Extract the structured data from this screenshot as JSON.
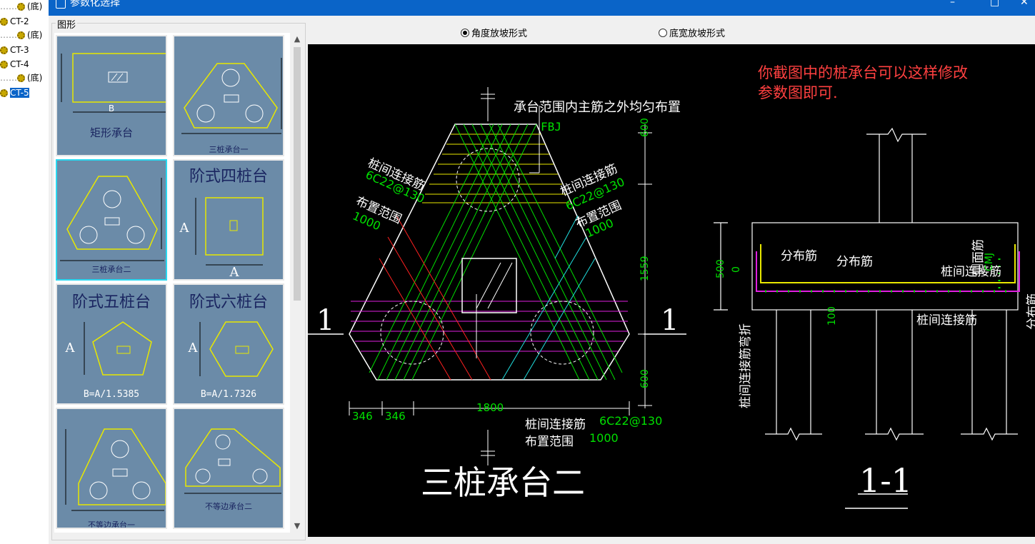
{
  "tree": {
    "items": [
      {
        "label": "(底)"
      },
      {
        "label": "CT-2"
      },
      {
        "label": "(底)"
      },
      {
        "label": "CT-3"
      },
      {
        "label": "CT-4"
      },
      {
        "label": "(底)"
      },
      {
        "label": "CT-5"
      }
    ]
  },
  "window": {
    "title": "参数化选择"
  },
  "group": {
    "label": "图形"
  },
  "gallery": {
    "cards": [
      {
        "label": "矩形承台",
        "dim": "B"
      },
      {
        "label": "三桩承台一"
      },
      {
        "label": "三桩承台二"
      },
      {
        "label": "阶式四桩台",
        "dim": "A"
      },
      {
        "label": "阶式五桩台",
        "formula": "B=A/1.5385",
        "dim": "A"
      },
      {
        "label": "阶式六桩台",
        "formula": "B=A/1.7326",
        "dim": "A"
      },
      {
        "label": "不等边承台一"
      },
      {
        "label": "不等边承台二"
      }
    ]
  },
  "options": {
    "angle_slope": "角度放坡形式",
    "width_slope": "底宽放坡形式",
    "selected": "angle_slope"
  },
  "drawing": {
    "note_top": "承台范围内主筋之外均匀布置",
    "fbj": "FBJ",
    "left_tie": "桩间连接筋",
    "left_tie_spec": "6C22@130",
    "left_range": "布置范围",
    "left_range_val": "1000",
    "right_tie": "桩间连接筋",
    "right_tie_spec": "6C22@130",
    "right_range": "布置范围",
    "right_range_val": "1000",
    "dim_600_top": "600",
    "dim_1559": "1559",
    "dim_600_bot": "600",
    "dim_346a": "346",
    "dim_346b": "346",
    "dim_1800": "1800",
    "bottom_tie": "桩间连接筋",
    "bottom_tie_spec": "6C22@130",
    "bottom_range": "布置范围",
    "bottom_range_val": "1000",
    "section_mark": "1",
    "title": "三桩承台二",
    "section_title": "1-1",
    "comment_line1": "你截图中的桩承台可以这样修改",
    "comment_line2": "参数图即可.",
    "sec_fenbu1": "分布筋",
    "sec_fenbu2": "分布筋",
    "sec_tie": "桩间连接筋",
    "sec_tie_bottom": "桩间连接筋",
    "sec_side": "侧面筋",
    "sec_cmj": "CMJ",
    "sec_500": "500",
    "sec_0": "0",
    "sec_100": "100",
    "sec_left_vert": "桩间连接筋弯折",
    "sec_right_vert": "分布筋"
  },
  "colors": {
    "titlebar": "#0a64c8",
    "card": "#6b8ba8",
    "selected_border": "#2ad8f0"
  }
}
